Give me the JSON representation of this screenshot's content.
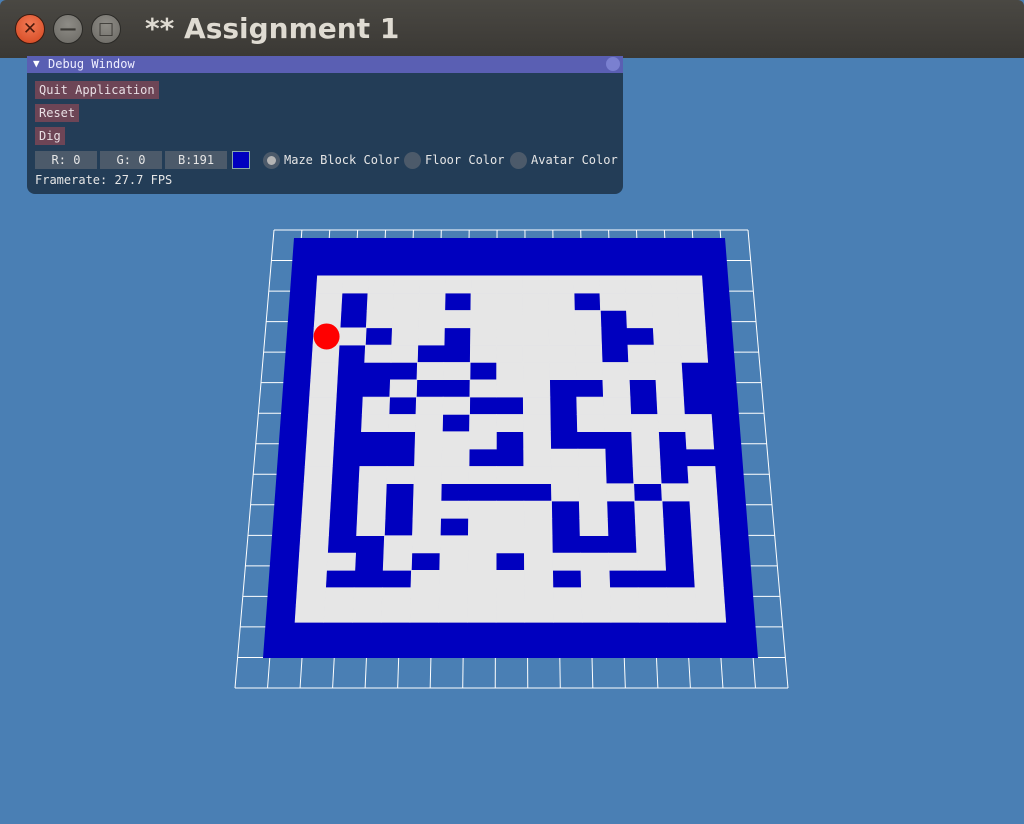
{
  "window": {
    "title": "** Assignment 1",
    "buttons": {
      "close_icon": "close-icon",
      "minimize_icon": "minimize-icon",
      "maximize_icon": "maximize-icon"
    }
  },
  "debug_window": {
    "title": "Debug Window",
    "collapse_arrow": "▼",
    "buttons": {
      "quit": "Quit Application",
      "reset": "Reset",
      "dig": "Dig"
    },
    "color": {
      "r_label": "R:  0",
      "g_label": "G:  0",
      "b_label": "B:191",
      "r": 0,
      "g": 0,
      "b": 191,
      "swatch": "#0000bf"
    },
    "radios": [
      {
        "label": "Maze Block Color",
        "selected": true
      },
      {
        "label": "Floor Color",
        "selected": false
      },
      {
        "label": "Avatar Color",
        "selected": false
      }
    ],
    "framerate": "Framerate: 27.7 FPS"
  },
  "scene": {
    "background": "#4a7fb4",
    "block_color": "#0000bf",
    "floor_color": "#e6e6e6",
    "grid_color": "#ffffff",
    "avatar_color": "#ff0000",
    "maze": [
      "...............",
      ".#...#....#....",
      ".#.........#...",
      "..#..#.....##..",
      ".#..##.....#...",
      ".###..#.......#",
      ".##.##...##.#.#",
      ".#.#..##.#..#.#",
      ".#...#...#.....",
      ".###...#.###.#.",
      ".###..##...#.##",
      ".#.........#.#.",
      ".#.#.####...#..",
      ".#.#.....#.#.#.",
      ".#.#.#...#.#.#.",
      ".##......###.#.",
      "..#.#..#.....#.",
      ".###.....#.###.",
      "...............",
      "..............."
    ],
    "avatar": {
      "row": 3,
      "col": 0
    }
  }
}
